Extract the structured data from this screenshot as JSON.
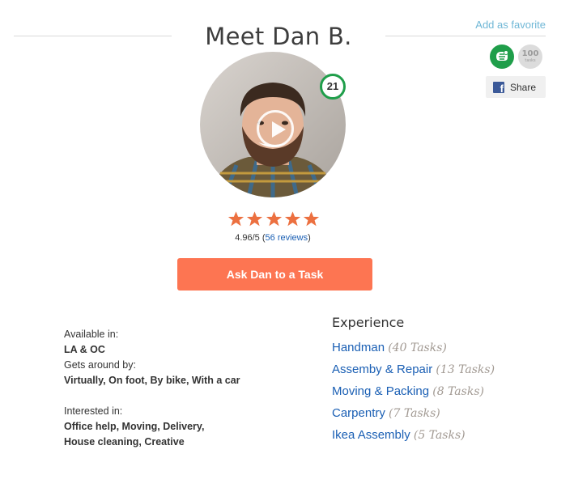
{
  "header": {
    "title": "Meet Dan B.",
    "add_favorite": "Add as favorite"
  },
  "badges": {
    "tasks_count": "100",
    "tasks_label": "tasks",
    "elite_icon": "elite-tasker-icon",
    "level": "21"
  },
  "share": {
    "label": "Share",
    "icon": "facebook-icon"
  },
  "rating": {
    "stars": 5,
    "score_text": "4.96/5 (",
    "reviews_text": "56 reviews",
    "close_paren": ")"
  },
  "cta": {
    "label": "Ask Dan to a Task"
  },
  "details": {
    "available_label": "Available in:",
    "available_value": "LA & OC",
    "gets_around_label": "Gets around by:",
    "gets_around_value": "Virtually, On foot,  By bike, With a car",
    "interested_label": "Interested in:",
    "interested_line1": "Office help, Moving, Delivery,",
    "interested_line2": "House cleaning, Creative"
  },
  "experience": {
    "heading": "Experience",
    "items": [
      {
        "category": "Handman",
        "count": "(40 Tasks)"
      },
      {
        "category": "Assemby & Repair",
        "count": "(13 Tasks)"
      },
      {
        "category": "Moving & Packing",
        "count": "(8 Tasks)"
      },
      {
        "category": "Carpentry",
        "count": " (7 Tasks)"
      },
      {
        "category": "Ikea Assembly",
        "count": "(5 Tasks)"
      }
    ]
  },
  "colors": {
    "accent": "#fd7552",
    "link": "#1a5fb4",
    "badge_green": "#1f9e4a",
    "star": "#ec7040"
  }
}
